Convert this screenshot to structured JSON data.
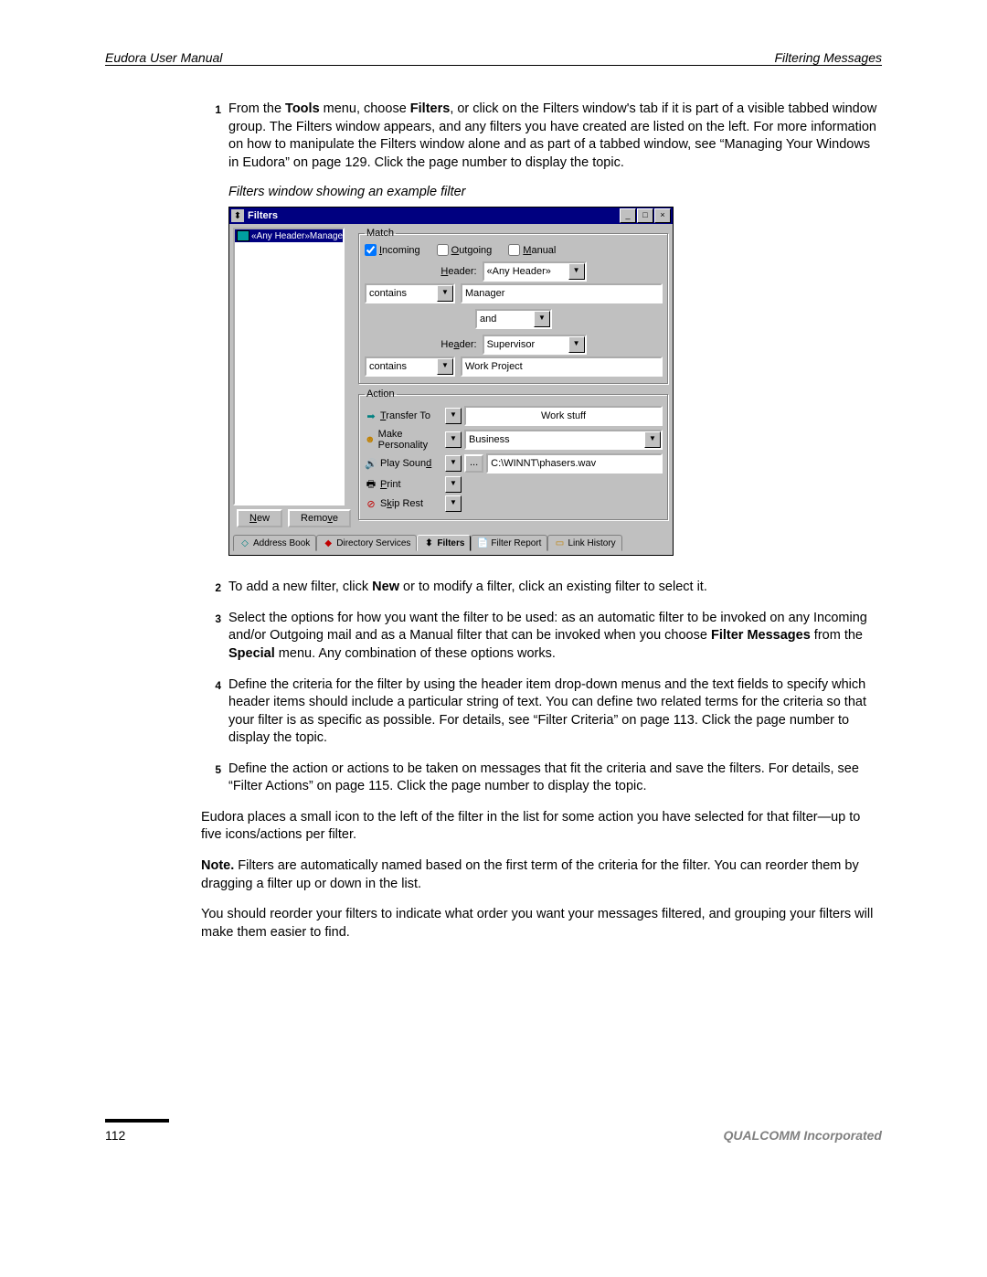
{
  "header": {
    "left": "Eudora User Manual",
    "right": "Filtering Messages"
  },
  "steps": {
    "s1_pre": "From the ",
    "s1_b1": "Tools",
    "s1_mid1": " menu, choose ",
    "s1_b2": "Filters",
    "s1_post": ", or click on the Filters window's tab if it is part of a visible tabbed window group. The Filters window appears, and any filters you have created are listed on the left. For more information on how to manipulate the Filters window alone and as part of a tabbed window, see “Managing Your Windows in Eudora” on page 129. Click the page number to display the topic.",
    "s2_pre": "To add a new filter, click ",
    "s2_b1": "New",
    "s2_post": " or to modify a filter, click an existing filter to select it.",
    "s3_pre": "Select the options for how you want the filter to be used: as an automatic filter to be invoked on any Incoming and/or Outgoing mail and as a Manual filter that can be invoked when you choose ",
    "s3_b1": "Filter Messages",
    "s3_mid": " from the ",
    "s3_b2": "Special",
    "s3_post": " menu. Any combination of these options works.",
    "s4": "Define the criteria for the filter by using the header item drop-down menus and the text fields to specify which header items should include a particular string of text. You can define two related terms for the criteria so that your filter is as specific as possible. For details, see “Filter Criteria” on page 113. Click the page number to display the topic.",
    "s5": "Define the action or actions to be taken on messages that fit the criteria and save the filters. For details, see “Filter Actions” on page 115. Click the page number to display the topic."
  },
  "caption": "Filters window showing an example filter",
  "para1": "Eudora places a small icon to the left of the filter in the list for some action you have selected for that filter—up to five icons/actions per filter.",
  "note_b": "Note.",
  "note_txt": " Filters are automatically named based on the first term of the criteria for the filter. You can reorder them by dragging a filter up or down in the list.",
  "para2": "You should reorder your filters to indicate what order you want your messages filtered, and grouping your filters will make them easier to find.",
  "footer": {
    "page": "112",
    "company": "QUALCOMM Incorporated"
  },
  "win": {
    "title": "Filters",
    "filter_item": "«Any Header»Manager",
    "match": {
      "legend": "Match",
      "incoming": "Incoming",
      "outgoing": "Outgoing",
      "manual": "Manual",
      "header_lbl": "Header:",
      "header1_val": "«Any Header»",
      "cond1": "contains",
      "text1": "Manager",
      "conj": "and",
      "header2_lbl": "Header:",
      "header2_val": "Supervisor",
      "cond2": "contains",
      "text2": "Work Project"
    },
    "action": {
      "legend": "Action",
      "a1": "Transfer To",
      "a1val": "Work stuff",
      "a2": "Make Personality",
      "a2val": "Business",
      "a3": "Play Sound",
      "a3val": "C:\\WINNT\\phasers.wav",
      "a4": "Print",
      "a5": "Skip Rest",
      "browse": "..."
    },
    "buttons": {
      "new": "New",
      "remove": "Remove"
    },
    "tabs": {
      "t1": "Address Book",
      "t2": "Directory Services",
      "t3": "Filters",
      "t4": "Filter Report",
      "t5": "Link History"
    }
  }
}
